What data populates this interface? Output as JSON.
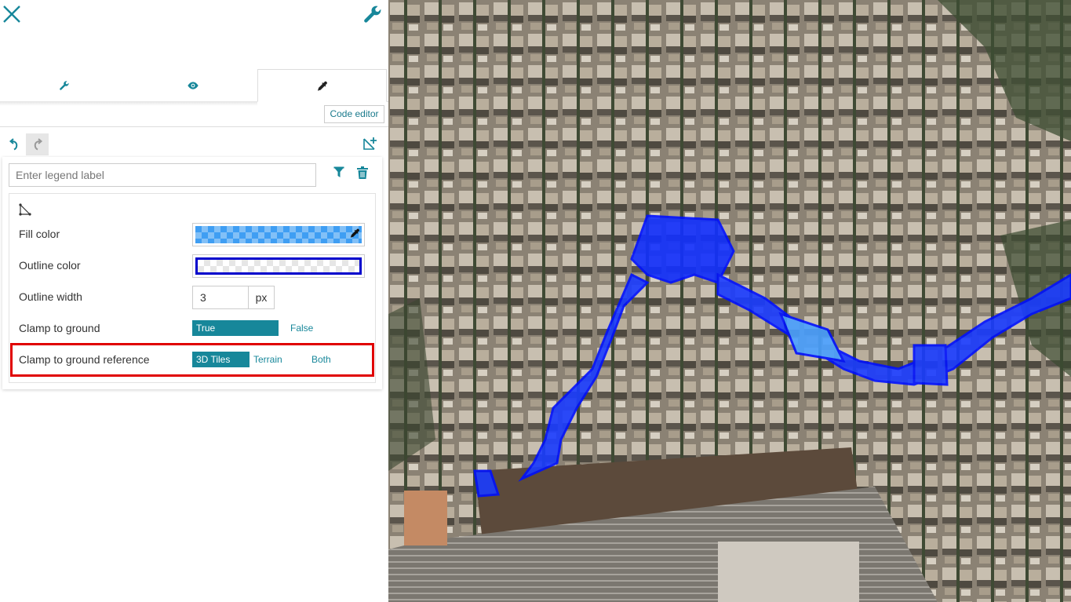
{
  "header": {
    "close_icon": "close-icon",
    "settings_icon": "wrench-icon"
  },
  "tabs": [
    {
      "icon": "wrench-icon",
      "active": false
    },
    {
      "icon": "eye-icon",
      "active": false
    },
    {
      "icon": "dropper-icon",
      "active": true
    }
  ],
  "toolbar": {
    "code_editor_label": "Code editor",
    "undo_icon": "undo-icon",
    "redo_icon": "redo-icon",
    "draw_icon": "draw-polygon-icon"
  },
  "legend": {
    "placeholder": "Enter legend label",
    "value": "",
    "filter_icon": "filter-icon",
    "delete_icon": "trash-icon"
  },
  "style": {
    "geometry_icon": "polygon-icon",
    "fill_color_label": "Fill color",
    "fill_color": "#3399ff",
    "outline_color_label": "Outline color",
    "outline_color": "#0000cc",
    "outline_width_label": "Outline width",
    "outline_width_value": "3",
    "outline_width_unit": "px",
    "clamp_label": "Clamp to ground",
    "clamp_options": [
      "True",
      "False"
    ],
    "clamp_selected": "True",
    "clamp_ref_label": "Clamp to ground reference",
    "clamp_ref_options": [
      "3D Tiles",
      "Terrain",
      "Both"
    ],
    "clamp_ref_selected": "3D Tiles"
  },
  "colors": {
    "accent": "#17879a",
    "highlight": "#e00000"
  },
  "map": {
    "view": "3D city view with blue polygon overlay"
  }
}
